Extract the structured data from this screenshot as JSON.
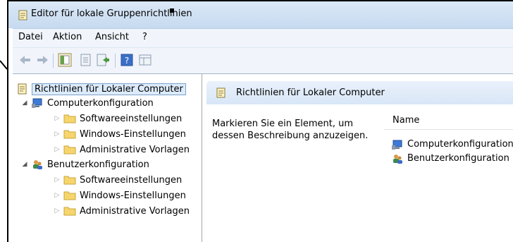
{
  "window": {
    "title": "Editor für lokale Gruppenrichtlinien"
  },
  "menu": [
    "Datei",
    "Aktion",
    "Ansicht",
    "?"
  ],
  "toolbar": {
    "buttons": [
      "back-icon",
      "forward-icon",
      "show-hide-tree-icon",
      "properties-icon",
      "export-list-icon",
      "help-icon",
      "show-filter-icon"
    ]
  },
  "tree": {
    "root": "Richtlinien für Lokaler Computer",
    "computer": {
      "label": "Computerkonfiguration",
      "children": [
        "Softwareeinstellungen",
        "Windows-Einstellungen",
        "Administrative Vorlagen"
      ]
    },
    "user": {
      "label": "Benutzerkonfiguration",
      "children": [
        "Softwareeinstellungen",
        "Windows-Einstellungen",
        "Administrative Vorlagen"
      ]
    }
  },
  "right": {
    "header": "Richtlinien für Lokaler Computer",
    "description": "Markieren Sie ein Element, um dessen Beschreibung anzuzeigen.",
    "column": "Name",
    "items": [
      "Computerkonfiguration",
      "Benutzerkonfiguration"
    ]
  },
  "colors": {
    "accent": "#c6daf0",
    "selection": "#dcebfc",
    "folder": "#f6d66c"
  }
}
